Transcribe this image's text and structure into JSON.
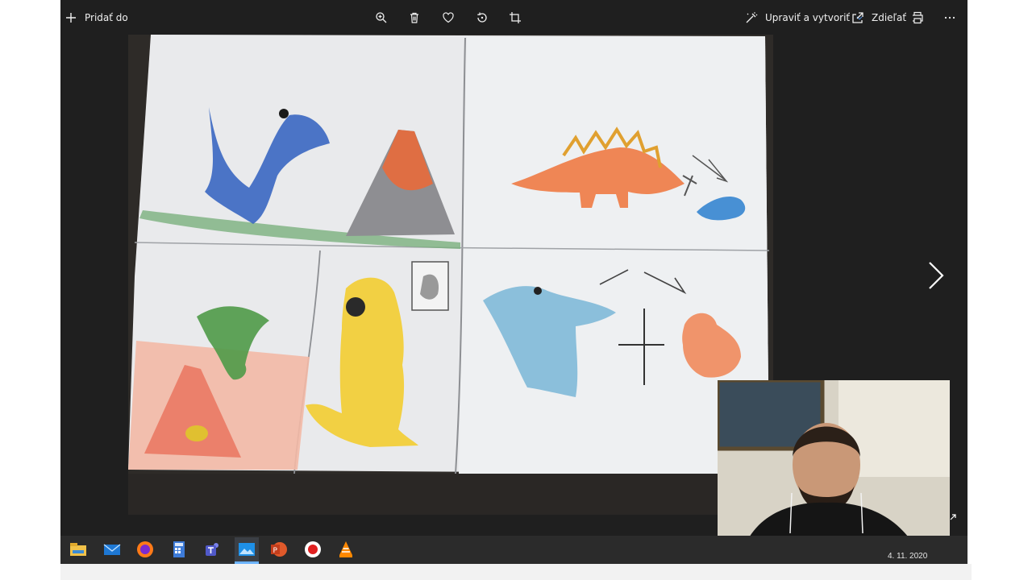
{
  "toolbar": {
    "add_to_label": "Pridať do",
    "edit_create_label": "Upraviť a vytvoriť",
    "share_label": "Zdieľať",
    "icons": [
      "plus-icon",
      "zoom-icon",
      "delete-icon",
      "favorite-icon",
      "rotate-icon",
      "crop-icon",
      "edit-create-icon",
      "chevron-down-icon",
      "share-icon",
      "print-icon",
      "more-icon"
    ]
  },
  "viewer": {
    "next_icon": "chevron-right-icon"
  },
  "taskbar": {
    "apps": [
      "file-explorer",
      "mail",
      "firefox",
      "calculator",
      "teams",
      "photos",
      "powerpoint",
      "recorder",
      "vlc"
    ],
    "clock_date": "4. 11. 2020"
  },
  "colors": {
    "window_bg": "#1f1f1f",
    "taskbar_bg": "#2b2b2b",
    "accent": "#4c8ad8"
  }
}
